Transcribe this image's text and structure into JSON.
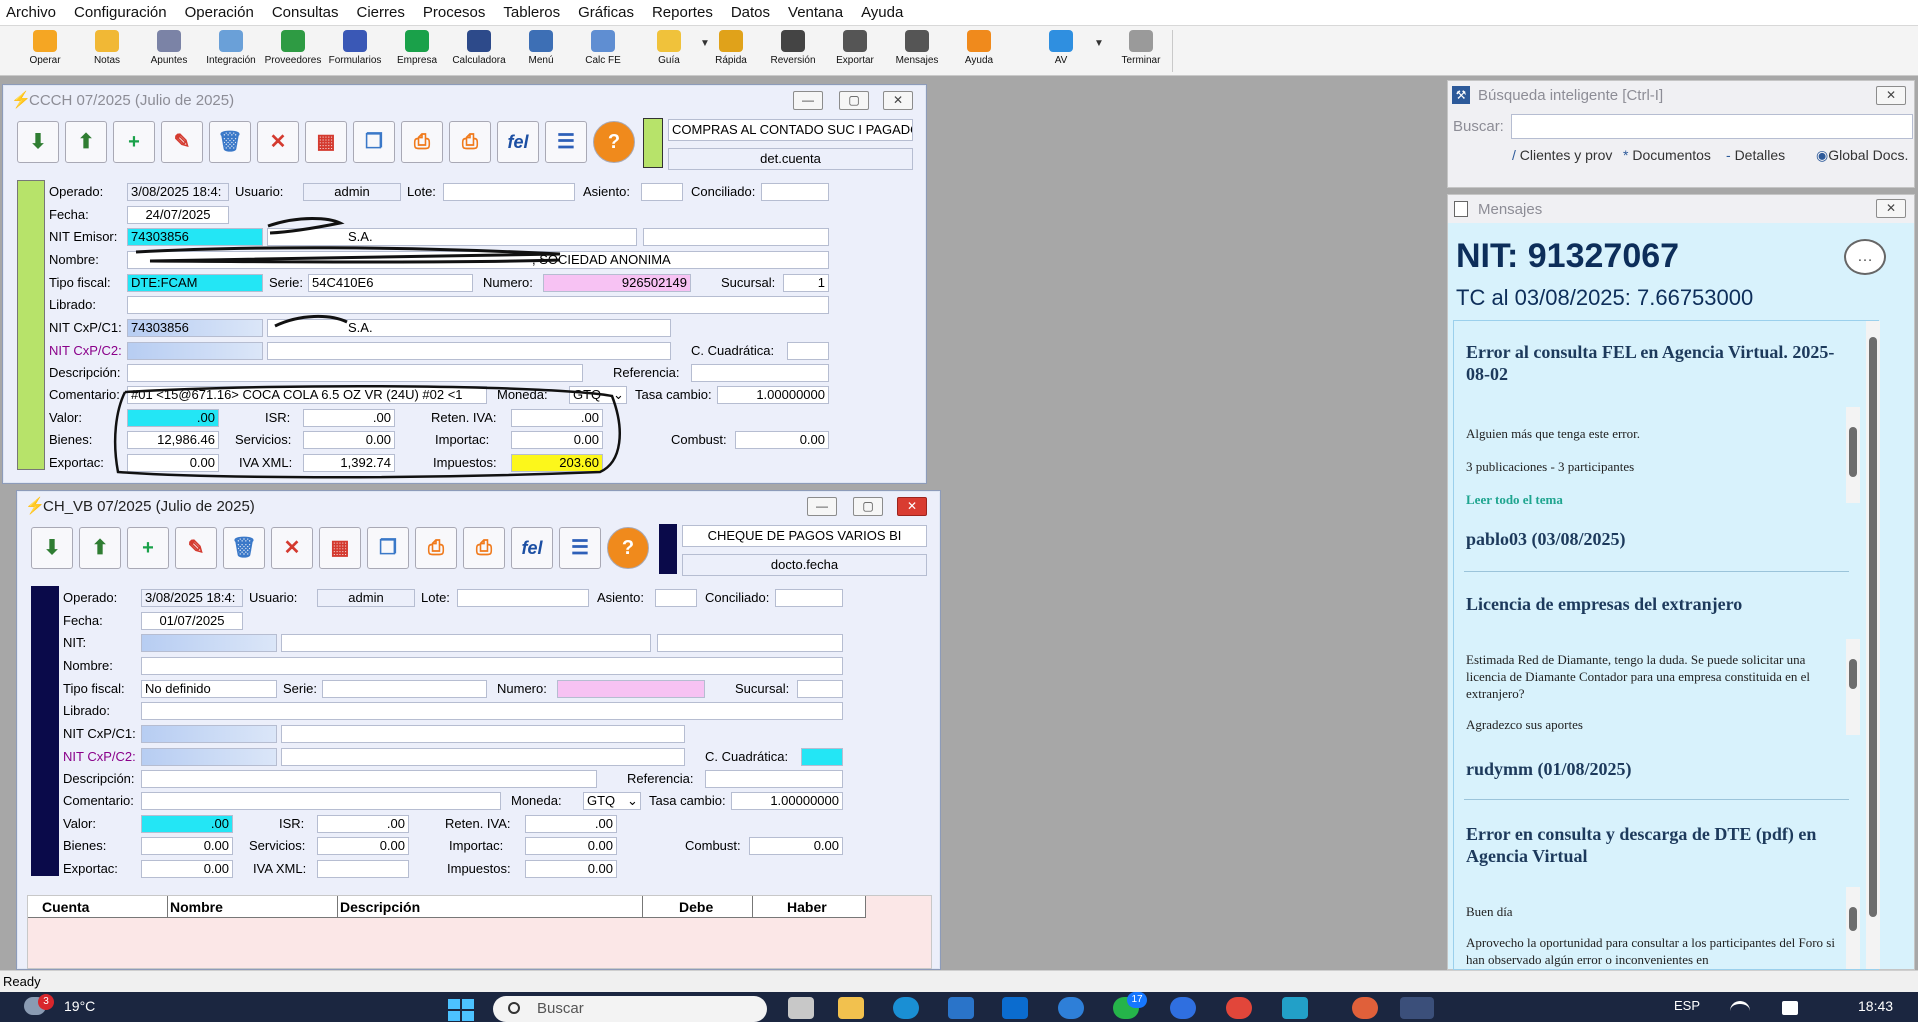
{
  "menu": [
    "Archivo",
    "Configuración",
    "Operación",
    "Consultas",
    "Cierres",
    "Procesos",
    "Tableros",
    "Gráficas",
    "Reportes",
    "Datos",
    "Ventana",
    "Ayuda"
  ],
  "toolbar": [
    {
      "label": "Operar",
      "icon": "bolt-icon",
      "color": "#f5a623"
    },
    {
      "label": "Notas",
      "icon": "notes-icon",
      "color": "#f1b835"
    },
    {
      "label": "Apuntes",
      "icon": "notebook-icon",
      "color": "#7b83a6"
    },
    {
      "label": "Integración",
      "icon": "integration-icon",
      "color": "#6aa0d8"
    },
    {
      "label": "Proveedores",
      "icon": "suppliers-icon",
      "color": "#2e9b43"
    },
    {
      "label": "Formularios",
      "icon": "forms-icon",
      "color": "#3a58b6"
    },
    {
      "label": "Empresa",
      "icon": "company-icon",
      "color": "#1aa14a"
    },
    {
      "label": "Calculadora",
      "icon": "calculator-icon",
      "color": "#2d4a8a"
    },
    {
      "label": "Menú",
      "icon": "menu-tree-icon",
      "color": "#3d6fb5"
    },
    {
      "label": "Calc FE",
      "icon": "calc-fe-icon",
      "color": "#5f8ed2"
    },
    {
      "label": "Guía",
      "icon": "guide-icon",
      "color": "#f0c23b"
    },
    {
      "label": "Rápida",
      "icon": "quick-icon",
      "color": "#e0a21a"
    },
    {
      "label": "Reversión",
      "icon": "reversal-icon",
      "color": "#444444"
    },
    {
      "label": "Exportar",
      "icon": "export-icon",
      "color": "#555555"
    },
    {
      "label": "Mensajes",
      "icon": "messages-icon",
      "color": "#555555"
    },
    {
      "label": "Ayuda",
      "icon": "help-icon",
      "color": "#f08a1c"
    },
    {
      "label": "AV",
      "icon": "av-icon",
      "color": "#2f8fe0"
    },
    {
      "label": "Terminar",
      "icon": "exit-door-icon",
      "color": "#9a9a9a"
    }
  ],
  "win1": {
    "title": "CCCH 07/2025 (Julio de 2025)",
    "doc_type": "COMPRAS AL CONTADO SUC I PAGADO",
    "sort": "det.cuenta",
    "labels": {
      "operado": "Operado:",
      "usuario": "Usuario:",
      "lote": "Lote:",
      "asiento": "Asiento:",
      "conciliado": "Conciliado:",
      "fecha": "Fecha:",
      "nit_emisor": "NIT Emisor:",
      "nombre": "Nombre:",
      "tipo_fiscal": "Tipo fiscal:",
      "serie": "Serie:",
      "numero": "Numero:",
      "sucursal": "Sucursal:",
      "librado": "Librado:",
      "nit_c1": "NIT CxP/C1:",
      "nit_c2": "NIT CxP/C2:",
      "c_cuadratica": "C. Cuadrática:",
      "descripcion": "Descripción:",
      "referencia": "Referencia:",
      "comentario": "Comentario:",
      "moneda": "Moneda:",
      "tasa": "Tasa cambio:",
      "valor": "Valor:",
      "isr": "ISR:",
      "reten_iva": "Reten. IVA:",
      "bienes": "Bienes:",
      "servicios": "Servicios:",
      "importac": "Importac:",
      "combust": "Combust:",
      "exportac": "Exportac:",
      "iva_xml": "IVA XML:",
      "impuestos": "Impuestos:"
    },
    "operado": "3/08/2025 18:4:",
    "usuario": "admin",
    "fecha": "24/07/2025",
    "nit_emisor": "74303856",
    "emisor_name": "S.A.",
    "nombre": ", SOCIEDAD ANONIMA",
    "tipo_fiscal": "DTE:FCAM",
    "serie": "54C410E6",
    "numero": "926502149",
    "sucursal": "1",
    "nit_c1": "74303856",
    "nit_c1_name": "S.A.",
    "comentario": "#01 <15@671.16> COCA COLA 6.5 OZ VR (24U) #02 <1",
    "moneda": "GTQ",
    "tasa": "1.00000000",
    "valor": ".00",
    "isr": ".00",
    "reten_iva": ".00",
    "bienes": "12,986.46",
    "servicios": "0.00",
    "importac": "0.00",
    "combust": "0.00",
    "exportac": "0.00",
    "iva_xml": "1,392.74",
    "impuestos": "203.60"
  },
  "win2": {
    "title": "CH_VB 07/2025 (Julio de 2025)",
    "doc_type": "CHEQUE DE PAGOS VARIOS BI",
    "sort": "docto.fecha",
    "labels": {
      "operado": "Operado:",
      "usuario": "Usuario:",
      "lote": "Lote:",
      "asiento": "Asiento:",
      "conciliado": "Conciliado:",
      "fecha": "Fecha:",
      "nit": "NIT:",
      "nombre": "Nombre:",
      "tipo_fiscal": "Tipo fiscal:",
      "serie": "Serie:",
      "numero": "Numero:",
      "sucursal": "Sucursal:",
      "librado": "Librado:",
      "nit_c1": "NIT CxP/C1:",
      "nit_c2": "NIT CxP/C2:",
      "c_cuadratica": "C. Cuadrática:",
      "descripcion": "Descripción:",
      "referencia": "Referencia:",
      "comentario": "Comentario:",
      "moneda": "Moneda:",
      "tasa": "Tasa cambio:",
      "valor": "Valor:",
      "isr": "ISR:",
      "reten_iva": "Reten. IVA:",
      "bienes": "Bienes:",
      "servicios": "Servicios:",
      "importac": "Importac:",
      "combust": "Combust:",
      "exportac": "Exportac:",
      "iva_xml": "IVA XML:",
      "impuestos": "Impuestos:"
    },
    "operado": "3/08/2025 18:4:",
    "usuario": "admin",
    "fecha": "01/07/2025",
    "tipo_fiscal": "No definido",
    "moneda": "GTQ",
    "tasa": "1.00000000",
    "valor": ".00",
    "isr": ".00",
    "reten_iva": ".00",
    "bienes": "0.00",
    "servicios": "0.00",
    "importac": "0.00",
    "combust": "0.00",
    "exportac": "0.00",
    "iva_xml": "",
    "impuestos": "0.00",
    "grid_headers": [
      "Cuenta",
      "Nombre",
      "Descripción",
      "Debe",
      "Haber"
    ]
  },
  "search": {
    "title": "Búsqueda inteligente [Ctrl-I]",
    "label": "Buscar:",
    "value": "",
    "options": [
      "Clientes y prov",
      "Documentos",
      "Detalles",
      "Global Docs."
    ]
  },
  "messages": {
    "title": "Mensajes",
    "nit": "NIT: 91327067",
    "tc": "TC al 03/08/2025: 7.66753000",
    "posts": [
      {
        "title": "Error al consulta FEL en Agencia Virtual. 2025-08-02",
        "lines": [
          "Alguien más que tenga este error.",
          "3 publicaciones - 3 participantes"
        ],
        "link": "Leer todo el tema",
        "author": "pablo03 (03/08/2025)"
      },
      {
        "title": "Licencia de empresas del extranjero",
        "lines": [
          "Estimada Red de Diamante, tengo la duda. Se puede solicitar una licencia de Diamante Contador para una empresa constituida en el extranjero?",
          "Agradezco sus aportes"
        ],
        "author": "rudymm (01/08/2025)"
      },
      {
        "title": "Error en consulta y descarga de DTE (pdf) en Agencia Virtual",
        "lines": [
          "Buen día",
          "Aprovecho la oportunidad para consultar a los participantes del Foro si han observado algún error o inconvenientes en"
        ]
      }
    ]
  },
  "status": "Ready",
  "taskbar": {
    "weather": "19°C",
    "badge": "3",
    "search_placeholder": "Buscar",
    "lang": "ESP",
    "time": "18:43",
    "chat_badge": "17"
  },
  "colors": {
    "cyan": "#23e6f5",
    "pink": "#f7c2f3",
    "yellow": "#fcf71b",
    "side_green": "#b7e36a",
    "side_navy": "#0a0a4a"
  }
}
